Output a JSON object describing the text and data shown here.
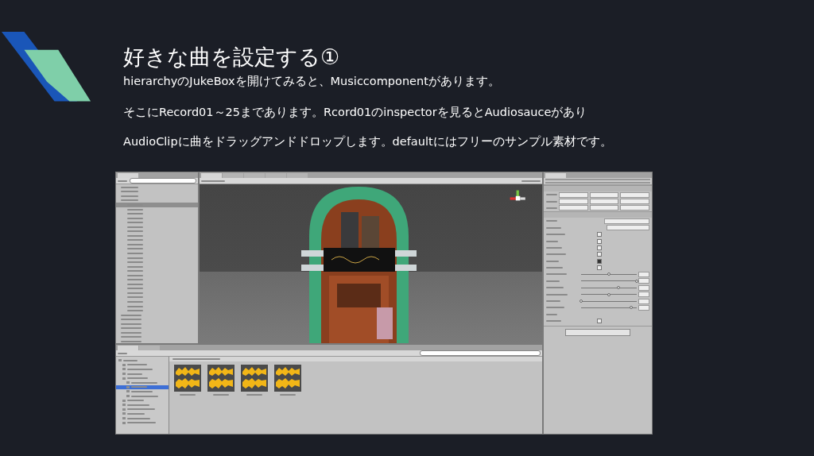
{
  "slide": {
    "title": "好きな曲を設定する①",
    "lines": [
      "hierarchyのJukeBoxを開けてみると、Musiccomponentがあります。",
      "そこにRecord01～25まであります。Rcord01のinspectorを見るとAudiosauceがあり",
      "AudioClipに曲をドラッグアンドドロップします。defaultにはフリーのサンプル素材です。"
    ]
  }
}
